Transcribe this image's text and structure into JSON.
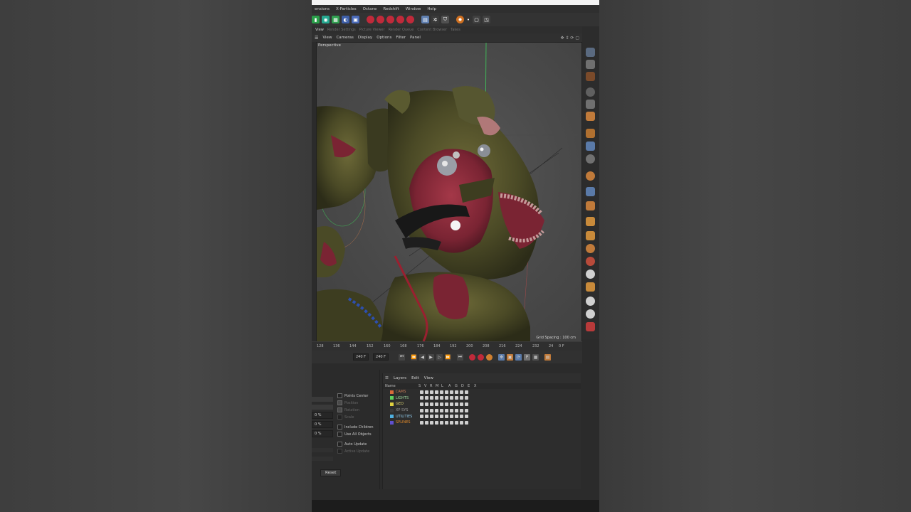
{
  "menu": [
    "ensions",
    "X-Particles",
    "Octane",
    "Redshift",
    "Window",
    "Help"
  ],
  "tabs": [
    "View",
    "Render Settings",
    "Picture Viewer",
    "Render Queue",
    "Content Browser",
    "Takes"
  ],
  "viewport_menu": [
    "View",
    "Cameras",
    "Display",
    "Options",
    "Filter",
    "Panel"
  ],
  "viewport": {
    "label": "Perspective",
    "grid_spacing": "Grid Spacing : 100 cm"
  },
  "timeline": {
    "ticks": [
      "128",
      "136",
      "144",
      "152",
      "160",
      "168",
      "176",
      "184",
      "192",
      "200",
      "208",
      "216",
      "224",
      "232",
      "24",
      "0 F"
    ],
    "end_frame_a": "240 F",
    "end_frame_b": "240 F"
  },
  "attributes": {
    "percent_fields": [
      "0 %",
      "0 %",
      "0 %"
    ],
    "checkboxes": [
      {
        "label": "Points Center",
        "enabled": true
      },
      {
        "label": "Position",
        "enabled": false
      },
      {
        "label": "Rotation",
        "enabled": false
      },
      {
        "label": "Scale",
        "enabled": false
      },
      {
        "label": "Include Children",
        "enabled": true
      },
      {
        "label": "Use All Objects",
        "enabled": true
      },
      {
        "label": "Auto Update",
        "enabled": true
      },
      {
        "label": "Active Update",
        "enabled": false
      }
    ],
    "reset_label": "Reset"
  },
  "objects": {
    "menu": [
      "Layers",
      "Edit",
      "View"
    ],
    "header": {
      "name": "Name",
      "cols": [
        "S",
        "V",
        "R",
        "M",
        "L",
        "A",
        "G",
        "D",
        "E",
        "X"
      ]
    },
    "rows": [
      {
        "name": "CAMS",
        "color": "#d86a3a",
        "text_color": "#c87a56"
      },
      {
        "name": "LIGHTS",
        "color": "#5fd05f",
        "text_color": "#9fd89f"
      },
      {
        "name": "GEO",
        "color": "#e0d040",
        "text_color": "#d8cf70"
      },
      {
        "name": "XP SYS",
        "color": "#3a3a3a",
        "text_color": "#9a9a9a"
      },
      {
        "name": "UTILITIES",
        "color": "#4fb0e0",
        "text_color": "#8ec8e8"
      },
      {
        "name": "SPLINES",
        "color": "#6050d0",
        "text_color": "#e0882a"
      }
    ]
  }
}
